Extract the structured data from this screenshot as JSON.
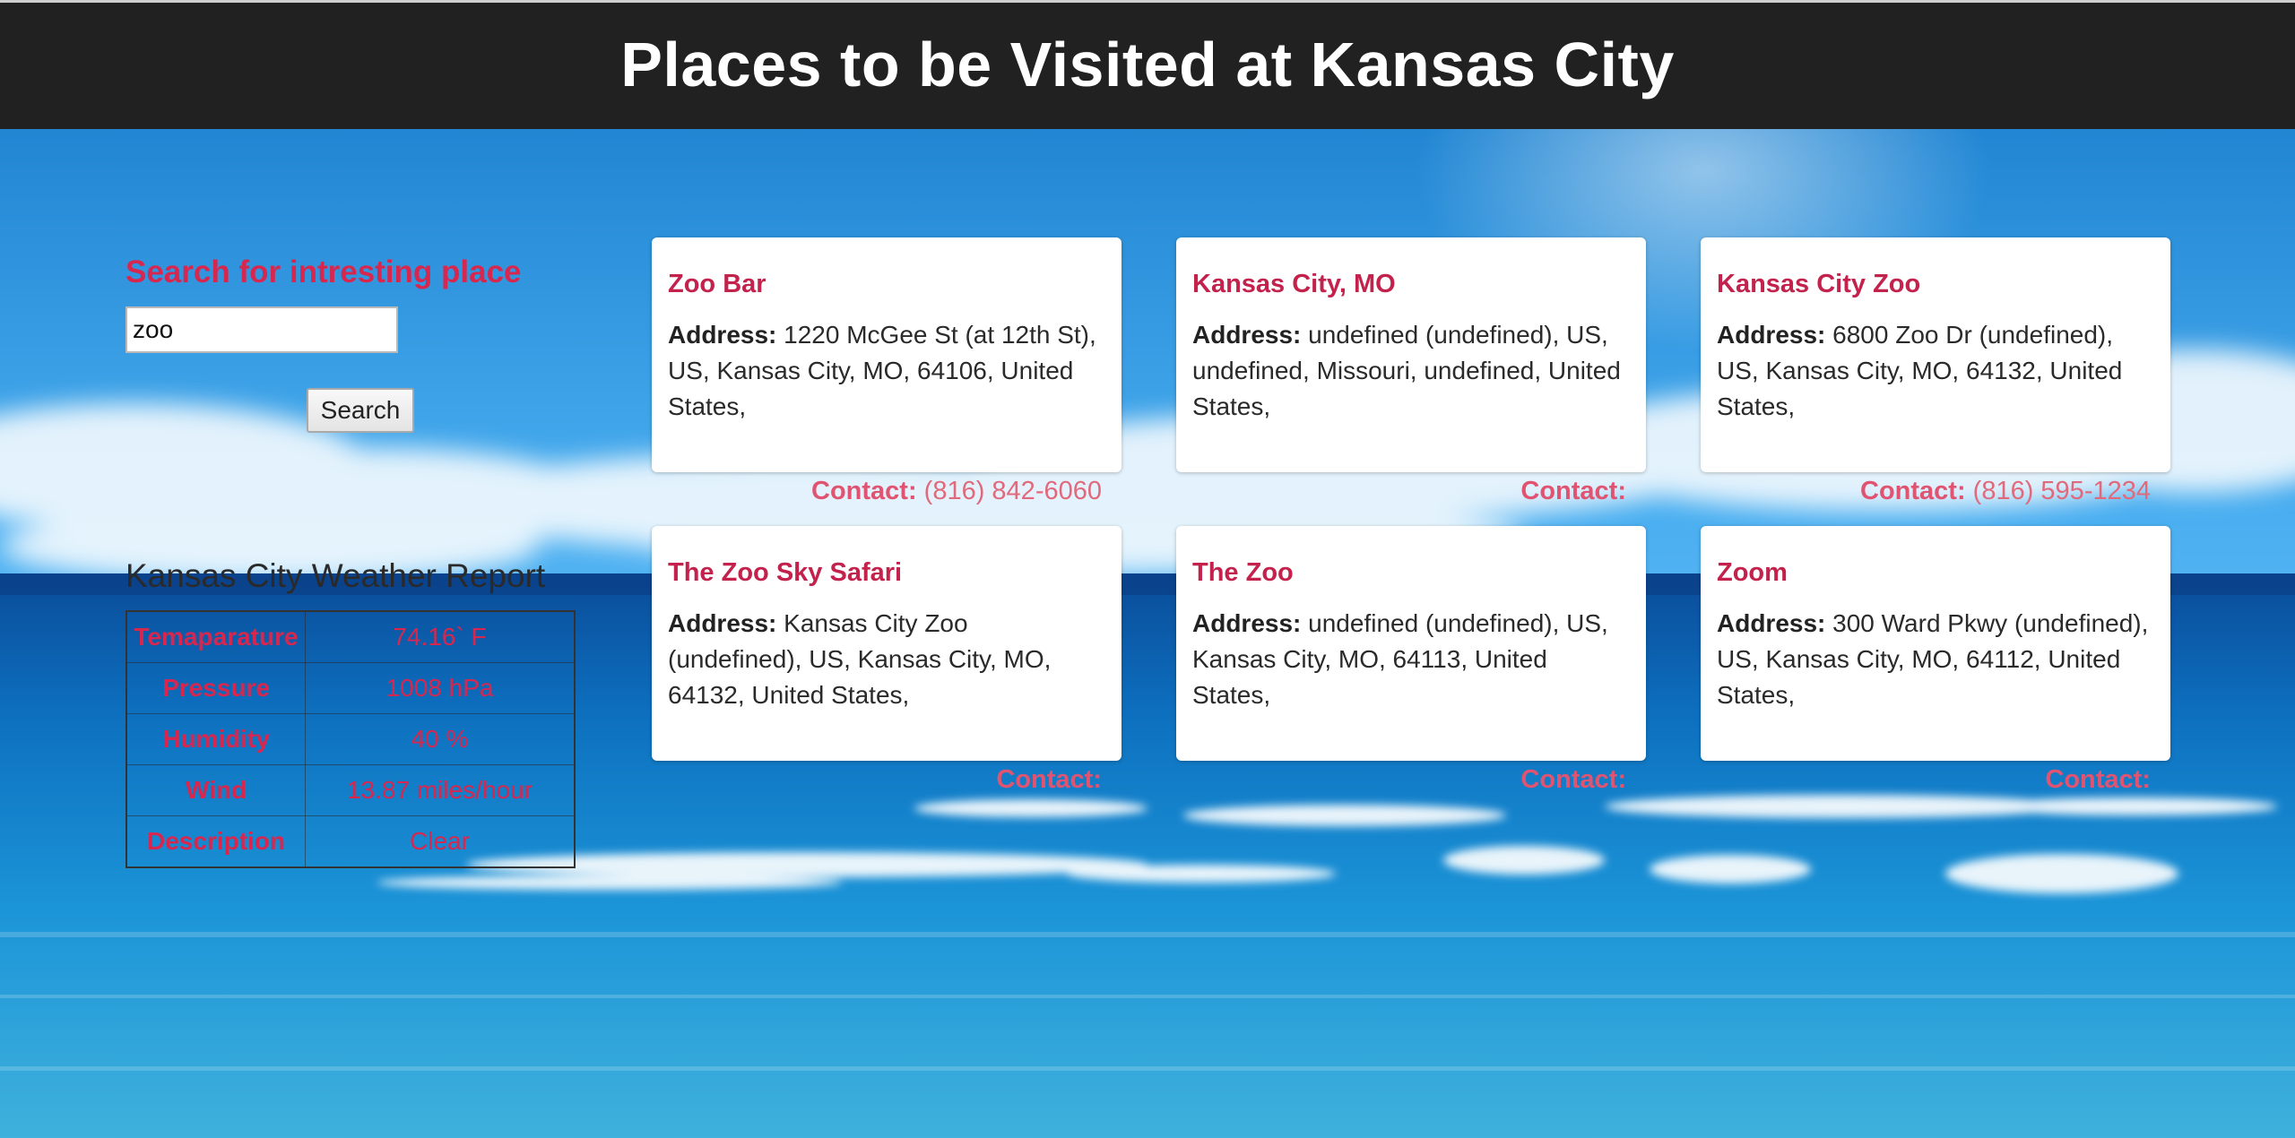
{
  "header": {
    "title": "Places to be Visited at Kansas City"
  },
  "search": {
    "heading": "Search for intresting place",
    "value": "zoo",
    "button_label": "Search"
  },
  "weather": {
    "title": "Kansas City Weather Report",
    "rows": [
      {
        "label": "Temaparature",
        "value": "74.16` F"
      },
      {
        "label": "Pressure",
        "value": "1008 hPa"
      },
      {
        "label": "Humidity",
        "value": "40 %"
      },
      {
        "label": "Wind",
        "value": "13.87 miles/hour"
      },
      {
        "label": "Description",
        "value": "Clear"
      }
    ]
  },
  "labels": {
    "address": "Address:",
    "contact": "Contact:"
  },
  "places": [
    {
      "name": "Zoo Bar",
      "address": "1220 McGee St (at 12th St), US, Kansas City, MO, 64106, United States,",
      "phone": "(816) 842-6060"
    },
    {
      "name": "Kansas City, MO",
      "address": "undefined (undefined), US, undefined, Missouri, undefined, United States,",
      "phone": ""
    },
    {
      "name": "Kansas City Zoo",
      "address": "6800 Zoo Dr (undefined), US, Kansas City, MO, 64132, United States,",
      "phone": "(816) 595-1234"
    },
    {
      "name": "The Zoo Sky Safari",
      "address": "Kansas City Zoo (undefined), US, Kansas City, MO, 64132, United States,",
      "phone": ""
    },
    {
      "name": "The Zoo",
      "address": "undefined (undefined), US, Kansas City, MO, 64113, United States,",
      "phone": ""
    },
    {
      "name": "Zoom",
      "address": "300 Ward Pkwy (undefined), US, Kansas City, MO, 64112, United States,",
      "phone": ""
    }
  ],
  "colors": {
    "header_bg": "#212121",
    "accent": "#d8274f",
    "card_title": "#c2224c",
    "contact": "#e06a7c"
  }
}
